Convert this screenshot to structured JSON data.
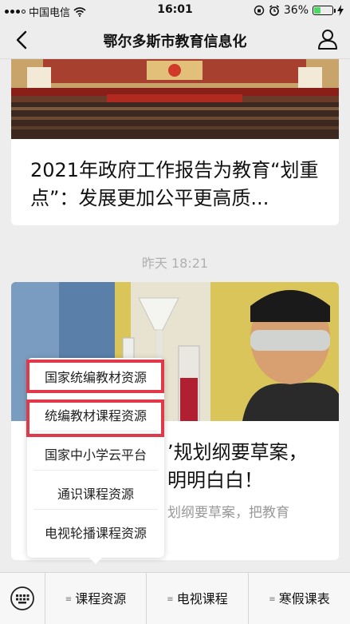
{
  "status": {
    "carrier": "中国电信",
    "time": "16:01",
    "battery": "36%",
    "battery_level": 0.36
  },
  "header": {
    "title": "鄂尔多斯市教育信息化"
  },
  "feed": {
    "article1": {
      "title": "2021年政府工作报告为教育“划重点”：发展更加公平更高质..."
    },
    "timestamp": "昨天 18:21",
    "article2": {
      "title": "’规划纲要草案，明明白白！",
      "subtitle": "划纲要草案，把教育"
    }
  },
  "popup_menu": {
    "items": [
      "国家统编教材资源",
      "统编教材课程资源",
      "国家中小学云平台",
      "通识课程资源",
      "电视轮播课程资源"
    ]
  },
  "bottom_tabs": [
    "课程资源",
    "电视课程",
    "寒假课表"
  ],
  "colors": {
    "highlight": "#e03a4a",
    "battery": "#4cd964"
  }
}
